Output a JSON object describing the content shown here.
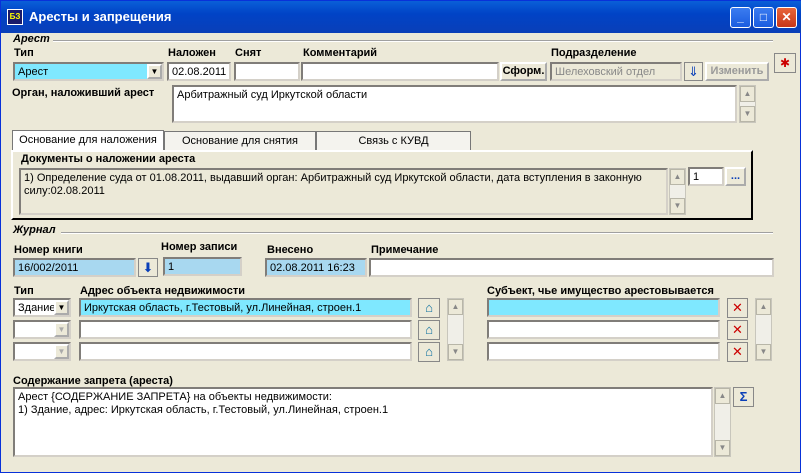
{
  "window": {
    "title": "Аресты и запрещения",
    "icon_text": "БЗ"
  },
  "arest": {
    "section": "Арест",
    "labels": {
      "type": "Тип",
      "nalozhen": "Наложен",
      "snyat": "Снят",
      "comment": "Комментарий",
      "podr": "Подразделение",
      "organ": "Орган, наложивший арест"
    },
    "type_value": "Арест",
    "nalozhen_value": "02.08.2011",
    "snyat_value": "",
    "comment_value": "",
    "sform_label": "Сформ.",
    "podr_value": "Шелеховский отдел",
    "izmenit_label": "Изменить",
    "organ_value": "Арбитражный суд Иркутской области"
  },
  "tabs": [
    {
      "label": "Основание для наложения"
    },
    {
      "label": "Основание для снятия"
    },
    {
      "label": "Связь с КУВД"
    }
  ],
  "docs": {
    "label": "Документы о наложении ареста",
    "text": "1) Определение суда от 01.08.2011, выдавший орган: Арбитражный суд Иркутской области, дата вступления в законную силу:02.08.2011",
    "count": "1",
    "more_label": "..."
  },
  "journal": {
    "section": "Журнал",
    "labels": {
      "book": "Номер книги",
      "record": "Номер записи",
      "entered": "Внесено",
      "note": "Примечание"
    },
    "book_value": "16/002/2011",
    "record_value": "1",
    "entered_value": "02.08.2011 16:23",
    "note_value": ""
  },
  "objects": {
    "labels": {
      "type": "Тип",
      "address": "Адрес объекта недвижимости",
      "subject": "Субъект, чье имущество арестовывается"
    },
    "rows": [
      {
        "type": "Здание",
        "address": "Иркутская область, г.Тестовый, ул.Линейная, строен.1",
        "subject": ""
      },
      {
        "type": "",
        "address": "",
        "subject": ""
      },
      {
        "type": "",
        "address": "",
        "subject": ""
      }
    ]
  },
  "content": {
    "label": "Содержание запрета (ареста)",
    "line1": "Арест {СОДЕРЖАНИЕ ЗАПРЕТА}  на объекты недвижимости:",
    "line2": "1) Здание, адрес: Иркутская область, г.Тестовый, ул.Линейная, строен.1",
    "sum_icon": "Σ"
  },
  "colors": {
    "title_bar": "#0a5fd8",
    "cyan_field": "#7fe8ff",
    "light_blue_field": "#a8d8f0"
  }
}
